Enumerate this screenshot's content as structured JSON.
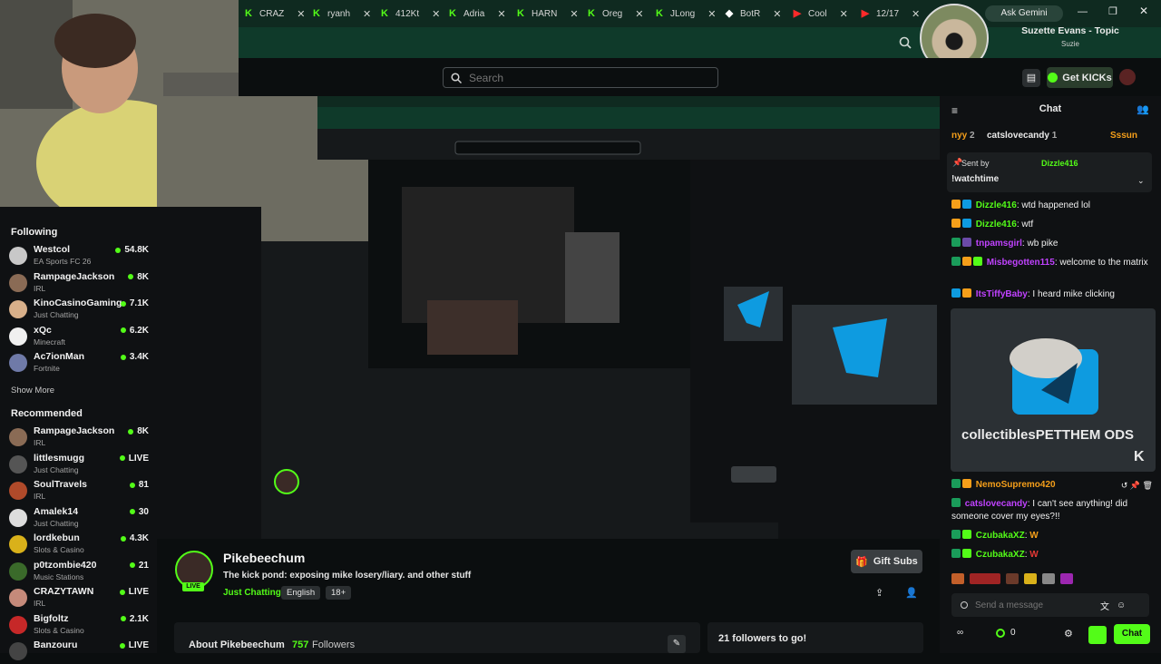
{
  "browser": {
    "tabs": [
      {
        "label": "CRAZ",
        "icon": "kick-icon",
        "color": "#53fc18"
      },
      {
        "label": "ryanh",
        "icon": "kick-icon",
        "color": "#53fc18"
      },
      {
        "label": "412Kt",
        "icon": "kick-icon",
        "color": "#53fc18"
      },
      {
        "label": "Adria",
        "icon": "kick-icon",
        "color": "#53fc18"
      },
      {
        "label": "HARN",
        "icon": "kick-icon",
        "color": "#53fc18"
      },
      {
        "label": "Oreg",
        "icon": "kick-icon",
        "color": "#53fc18"
      },
      {
        "label": "JLong",
        "icon": "kick-icon",
        "color": "#53fc18"
      },
      {
        "label": "BotR",
        "icon": "diamond-icon",
        "color": "#ffffff"
      },
      {
        "label": "Cool",
        "icon": "youtube-icon",
        "color": "#ff2a2a"
      },
      {
        "label": "12/17",
        "icon": "youtube-icon",
        "color": "#ff2a2a"
      }
    ],
    "ask_gemini": "Ask Gemini"
  },
  "now_playing": {
    "title": "Suzette Evans - Topic",
    "subtitle": "Suzie"
  },
  "header": {
    "search_placeholder": "Search",
    "get_kicks": "Get KICKs"
  },
  "sidebar": {
    "following_title": "Following",
    "following": [
      {
        "name": "Westcol",
        "category": "EA Sports FC 26",
        "viewers": "54.8K",
        "color": "#c8c8c8"
      },
      {
        "name": "RampageJackson",
        "category": "IRL",
        "viewers": "8K",
        "color": "#8a6b55"
      },
      {
        "name": "KinoCasinoGaming",
        "category": "Just Chatting",
        "viewers": "7.1K",
        "color": "#d8b08a"
      },
      {
        "name": "xQc",
        "category": "Minecraft",
        "viewers": "6.2K",
        "color": "#f0f0f0"
      },
      {
        "name": "Ac7ionMan",
        "category": "Fortnite",
        "viewers": "3.4K",
        "color": "#6f7aa8"
      }
    ],
    "show_more": "Show More",
    "recommended_title": "Recommended",
    "recommended": [
      {
        "name": "RampageJackson",
        "category": "IRL",
        "viewers": "8K",
        "color": "#8a6b55"
      },
      {
        "name": "littlesmugg",
        "category": "Just Chatting",
        "viewers": "LIVE",
        "color": "#555555"
      },
      {
        "name": "SoulTravels",
        "category": "IRL",
        "viewers": "81",
        "color": "#b04a2a"
      },
      {
        "name": "Amalek14",
        "category": "Just Chatting",
        "viewers": "30",
        "color": "#dddddd"
      },
      {
        "name": "lordkebun",
        "category": "Slots & Casino",
        "viewers": "4.3K",
        "color": "#d9b11a"
      },
      {
        "name": "p0tzombie420",
        "category": "Music Stations",
        "viewers": "21",
        "color": "#3a6a2a"
      },
      {
        "name": "CRAZYTAWN",
        "category": "IRL",
        "viewers": "LIVE",
        "color": "#c58a7a"
      },
      {
        "name": "Bigfoltz",
        "category": "Slots & Casino",
        "viewers": "2.1K",
        "color": "#c62828"
      },
      {
        "name": "Banzouru",
        "category": "",
        "viewers": "LIVE",
        "color": "#444444"
      }
    ]
  },
  "channel": {
    "name": "Pikebeechum",
    "title": "The kick pond: exposing mike losery/liary. and other stuff",
    "category": "Just Chatting",
    "tags": [
      "English",
      "18+"
    ],
    "live_label": "LIVE",
    "gift_subs": "Gift Subs",
    "about_prefix": "About Pikebeechum",
    "followers_count": "757",
    "followers_label": "Followers",
    "followers_goal": "21 followers to go!"
  },
  "chat": {
    "title": "Chat",
    "top_users": [
      {
        "name": "nyy",
        "count": "2"
      },
      {
        "name": "catslovecandy",
        "count": "1"
      },
      {
        "name": "Sssun",
        "count": ""
      }
    ],
    "pinned_sent_by": "Sent by",
    "pinned_user": "Dizzle416",
    "pinned_message": "!watchtime",
    "messages": [
      {
        "user": "Dizzle416",
        "text": "wtd happened lol",
        "color": "#53fc18"
      },
      {
        "user": "Dizzle416",
        "text": "wtf",
        "color": "#53fc18"
      },
      {
        "user": "tnpamsgirl",
        "text": "wb pike",
        "color": "#c042ff"
      },
      {
        "user": "Misbegotten115",
        "text": "welcome to the matrix",
        "color": "#c042ff"
      },
      {
        "user": "ItsTiffyBaby",
        "text": "I heard mike clicking",
        "color": "#c042ff"
      },
      {
        "user": "NemoSupremo420",
        "text": "",
        "color": "#f59f1a"
      },
      {
        "user": "catslovecandy",
        "text": "I can't see anything! did someone cover my eyes?!!",
        "color": "#c042ff"
      },
      {
        "user": "CzubakaXZ",
        "text": "W",
        "color": "#53fc18"
      },
      {
        "user": "CzubakaXZ",
        "text": "W",
        "color": "#53fc18"
      }
    ],
    "collectibles": "collectiblesPETTHEM ODS",
    "send_placeholder": "Send a message",
    "kicks_count": "0",
    "chat_button": "Chat"
  }
}
